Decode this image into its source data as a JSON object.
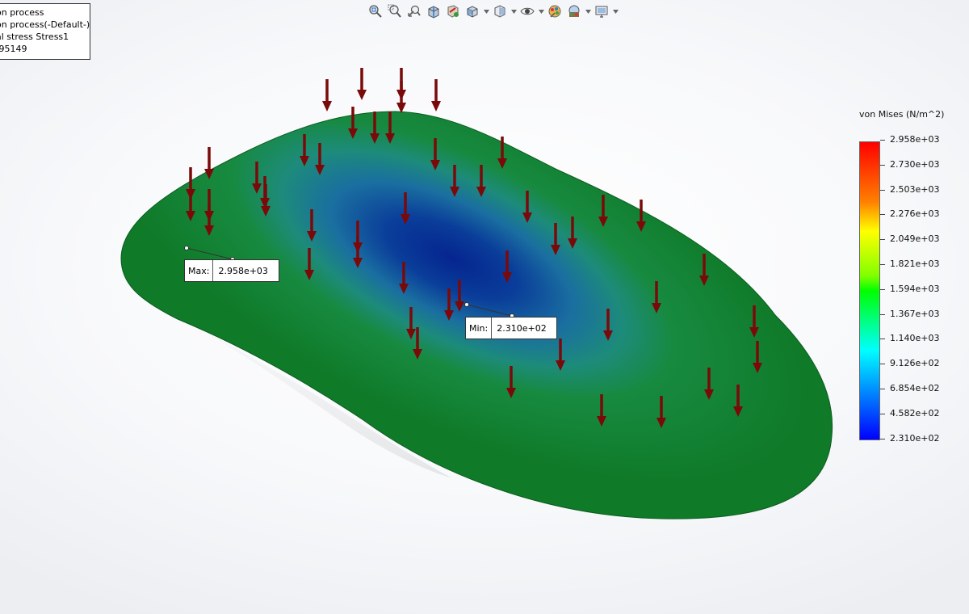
{
  "info_lines": [
    "on process",
    "on process(-Default-)",
    "al stress Stress1",
    ".95149"
  ],
  "toolbar": {
    "buttons": [
      {
        "icon": "zoom-to-fit-icon"
      },
      {
        "icon": "zoom-to-area-icon"
      },
      {
        "icon": "previous-view-icon"
      },
      {
        "icon": "section-view-icon"
      },
      {
        "icon": "view-results-icon"
      },
      {
        "icon": "view-orientation-icon",
        "dropdown": true
      },
      {
        "icon": "display-style-icon",
        "dropdown": true
      },
      {
        "icon": "hide-show-items-icon",
        "dropdown": true
      },
      {
        "icon": "edit-appearance-icon"
      },
      {
        "icon": "apply-scene-icon",
        "dropdown": true
      },
      {
        "icon": "view-settings-icon",
        "dropdown": true
      }
    ]
  },
  "legend": {
    "title": "von Mises (N/m^2)",
    "ticks": [
      "2.958e+03",
      "2.730e+03",
      "2.503e+03",
      "2.276e+03",
      "2.049e+03",
      "1.821e+03",
      "1.594e+03",
      "1.367e+03",
      "1.140e+03",
      "9.126e+02",
      "6.854e+02",
      "4.582e+02",
      "2.310e+02"
    ]
  },
  "probes": {
    "max": {
      "label": "Max:",
      "value": "2.958e+03"
    },
    "min": {
      "label": "Min:",
      "value": "2.310e+02"
    }
  },
  "colors": {
    "model_edge": "#137a2e",
    "model_mid": "#1f9070",
    "model_center": "#062f9a",
    "load_arrow": "#7a0a0a"
  }
}
